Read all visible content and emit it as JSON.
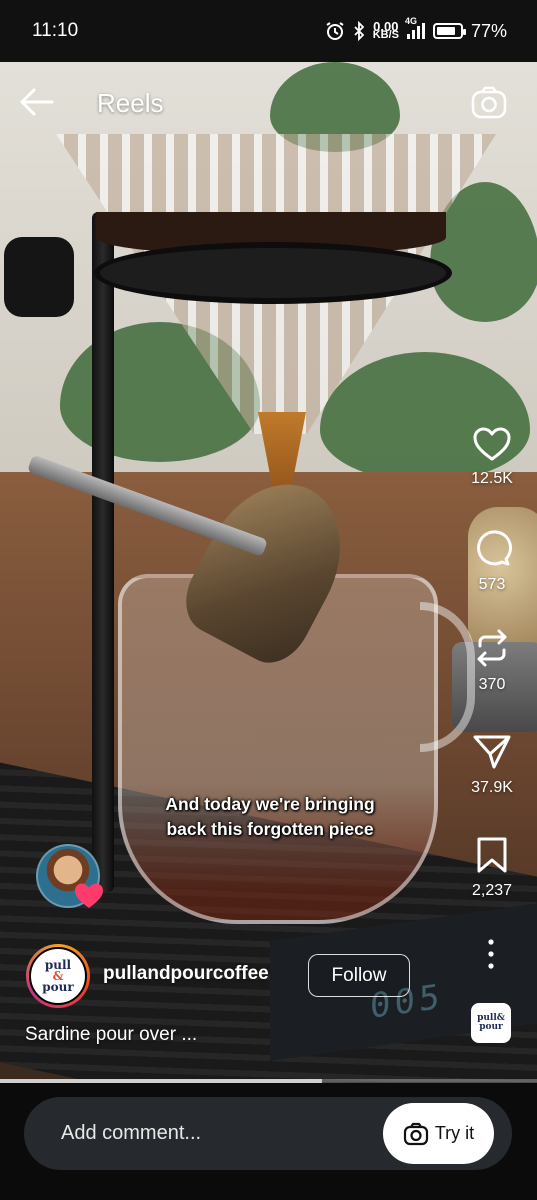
{
  "status_bar": {
    "time": "11:10",
    "net_speed": "0.00",
    "net_unit": "KB/S",
    "network": "4G",
    "battery": "77%",
    "battery_level": 0.77,
    "icons": [
      "alarm-icon",
      "bluetooth-icon",
      "signal-icon",
      "battery-icon"
    ]
  },
  "header": {
    "title": "Reels"
  },
  "video": {
    "caption_line1": "And today we're bringing",
    "caption_line2": "back this forgotten piece",
    "scale_display": "005"
  },
  "actions": {
    "likes": "12.5K",
    "comments": "573",
    "reposts": "370",
    "shares": "37.9K",
    "saves": "2,237"
  },
  "author": {
    "avatar_text_1": "pull",
    "avatar_text_2": "&",
    "avatar_text_3": "pour",
    "username": "pullandpourcoffee",
    "follow_label": "Follow",
    "description": "Sardine pour over ..."
  },
  "audio": {
    "thumb_text_1": "pull&",
    "thumb_text_2": "pour"
  },
  "playback": {
    "progress": 0.6
  },
  "comment_bar": {
    "placeholder": "Add comment...",
    "try_label": "Try it"
  },
  "colors": {
    "background": "#000000",
    "comment_box": "#262a2f",
    "text": "#ffffff"
  }
}
